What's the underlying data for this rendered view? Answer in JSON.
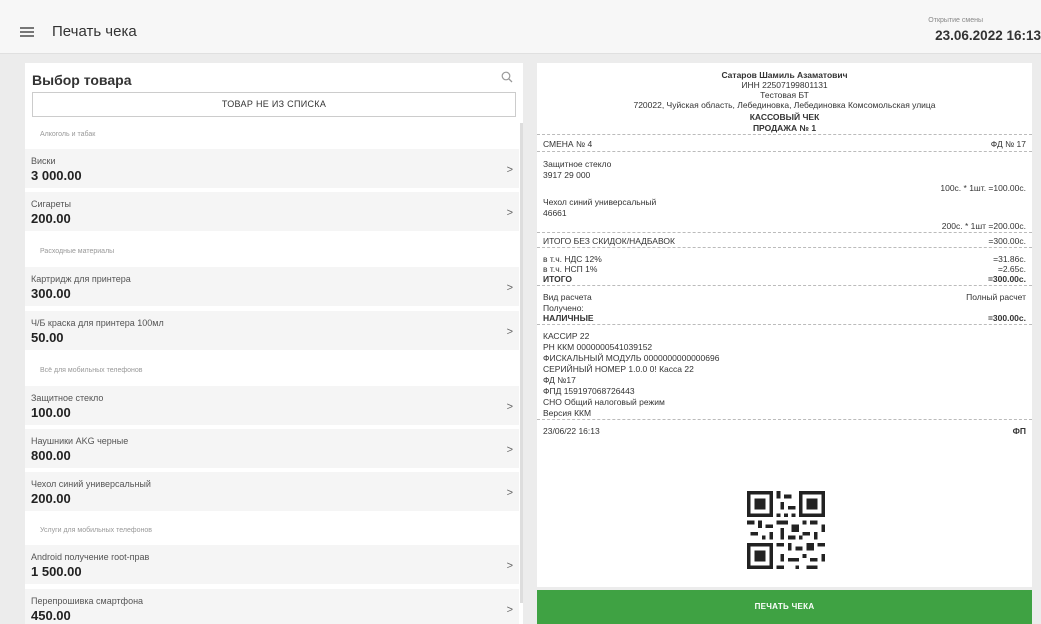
{
  "header": {
    "title": "Печать чека",
    "shift_label": "Открытие смены",
    "shift_datetime": "23.06.2022 16:13"
  },
  "catalog": {
    "title": "Выбор товара",
    "not_in_list_button": "ТОВАР НЕ ИЗ СПИСКА",
    "categories": [
      "Алкоголь и табак",
      "Расходные материалы",
      "Всё для мобильных телефонов",
      "Услуги для мобильных телефонов"
    ],
    "items": [
      {
        "name": "Виски",
        "price": "3 000.00"
      },
      {
        "name": "Сигареты",
        "price": "200.00"
      },
      {
        "name": "Картридж для принтера",
        "price": "300.00"
      },
      {
        "name": "Ч/Б краска для принтера 100мл",
        "price": "50.00"
      },
      {
        "name": "Защитное стекло",
        "price": "100.00"
      },
      {
        "name": "Наушники AKG черные",
        "price": "800.00"
      },
      {
        "name": "Чехол синий универсальный",
        "price": "200.00"
      },
      {
        "name": "Android получение root-прав",
        "price": "1 500.00"
      },
      {
        "name": "Перепрошивка смартфона",
        "price": "450.00"
      }
    ]
  },
  "receipt": {
    "owner": "Сатаров Шамиль Азаматович",
    "inn": "ИНН 22507199801131",
    "store": "Тестовая БТ",
    "address": "720022, Чуйская область, Лебединовка, Лебединовка Комсомольская улица",
    "doc_type": "КАССОВЫЙ ЧЕК",
    "sale": "ПРОДАЖА № 1",
    "shift": "СМЕНА № 4",
    "fd": "ФД № 17",
    "line1_name": "Защитное стекло",
    "line1_code": "3917 29 000",
    "line1_calc": "100с. * 1шт. =100.00с.",
    "line2_name": "Чехол синий универсальный",
    "line2_code": "46661",
    "line2_calc": "200с. * 1шт =200.00с.",
    "subtotal_label": "ИТОГО БЕЗ СКИДОК/НАДБАВОК",
    "subtotal_value": "=300.00с.",
    "vat_label": "в т.ч. НДС 12%",
    "vat_value": "=31.86с.",
    "nsp_label": "в т.ч. НСП 1%",
    "nsp_value": "=2.65с.",
    "total_label": "ИТОГО",
    "total_value": "=300.00с.",
    "payment_label": "Вид расчета",
    "payment_value": "Полный расчет",
    "received_label": "Получено:",
    "cash_label": "НАЛИЧНЫЕ",
    "cash_value": "=300.00с.",
    "cashier": "КАССИР 22",
    "rn_kkm": "РН ККМ 0000000541039152",
    "fiscal_module": "ФИСКАЛЬНЫЙ МОДУЛЬ 0000000000000696",
    "serial": "СЕРИЙНЫЙ НОМЕР 1.0.0 0! Касса 22",
    "fd_no": "ФД №17",
    "fpd": "ФПД 159197068726443",
    "sno": "СНО Общий налоговый режим",
    "kkm_version": "Версия ККМ",
    "datetime": "23/06/22 16:13",
    "fp": "ФП"
  },
  "print_button": "ПЕЧАТЬ ЧЕКА",
  "colors": {
    "accent_green": "#3fa243"
  }
}
